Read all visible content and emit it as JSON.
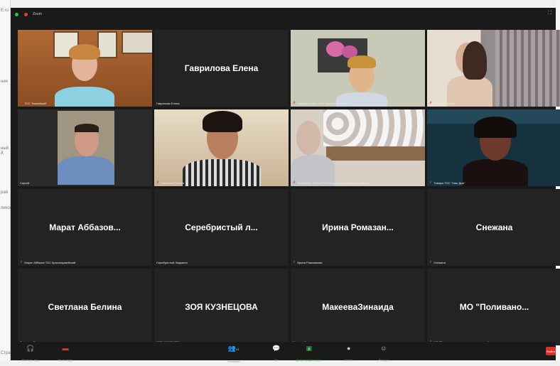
{
  "window": {
    "title": "Zoom"
  },
  "background": {
    "snippets": [
      "E.ru",
      "ния",
      "ный д",
      "рай",
      "лекое",
      "Стра"
    ]
  },
  "participants": [
    {
      "name": "ТОС \"Вишнёвый\"",
      "big": "",
      "muted": true,
      "video": true
    },
    {
      "name": "Гаврилова Елена",
      "big": "Гаврилова Елена",
      "muted": false,
      "video": false
    },
    {
      "name": "Суркова Елена ТОС \"Краснояровское\"",
      "big": "",
      "muted": true,
      "video": true
    },
    {
      "name": "Сенченко Дарья",
      "big": "",
      "muted": true,
      "video": true
    },
    {
      "name": "Сергей",
      "big": "",
      "muted": false,
      "video": true,
      "active": true
    },
    {
      "name": "Светлана Панова",
      "big": "",
      "muted": true,
      "video": true
    },
    {
      "name": "Лыбаченко Галина ТОС Бадовское городского района",
      "big": "",
      "muted": true,
      "video": true
    },
    {
      "name": "Тамара ТОС \"Наш Дом\"",
      "big": "",
      "muted": true,
      "video": true
    },
    {
      "name": "Марат Аббазов ТОС Красноармейский",
      "big": "Марат  Аббазов...",
      "muted": true,
      "video": false
    },
    {
      "name": "Серебристый Людмила",
      "big": "Серебристый  л...",
      "muted": false,
      "video": false
    },
    {
      "name": "Ирина Ромазанова",
      "big": "Ирина  Ромазан...",
      "muted": true,
      "video": false
    },
    {
      "name": "Снежана",
      "big": "Снежана",
      "muted": true,
      "video": false
    },
    {
      "name": "Светлана Белина",
      "big": "Светлана Белина",
      "muted": false,
      "video": false
    },
    {
      "name": "ЗОЯ КУЗНЕЦОВА",
      "big": "ЗОЯ КУЗНЕЦОВА",
      "muted": false,
      "video": false
    },
    {
      "name": "МакееваЗинаида",
      "big": "МакееваЗинаида",
      "muted": false,
      "video": false
    },
    {
      "name": "МО \"Поливановское сельское поселение\"",
      "big": "МО  \"Поливано...",
      "muted": true,
      "video": false
    }
  ],
  "toolbar": {
    "audio": "Включить звук",
    "video": "Начать видео",
    "participants": "Участники",
    "participants_count": "19",
    "chat": "Чат",
    "share": "Демонстрация экрана",
    "record": "Запись",
    "reactions": "Реакции",
    "end": "Выйти"
  },
  "colors": {
    "accent": "#b7c544",
    "mute": "#e03030",
    "end": "#d9312a"
  }
}
